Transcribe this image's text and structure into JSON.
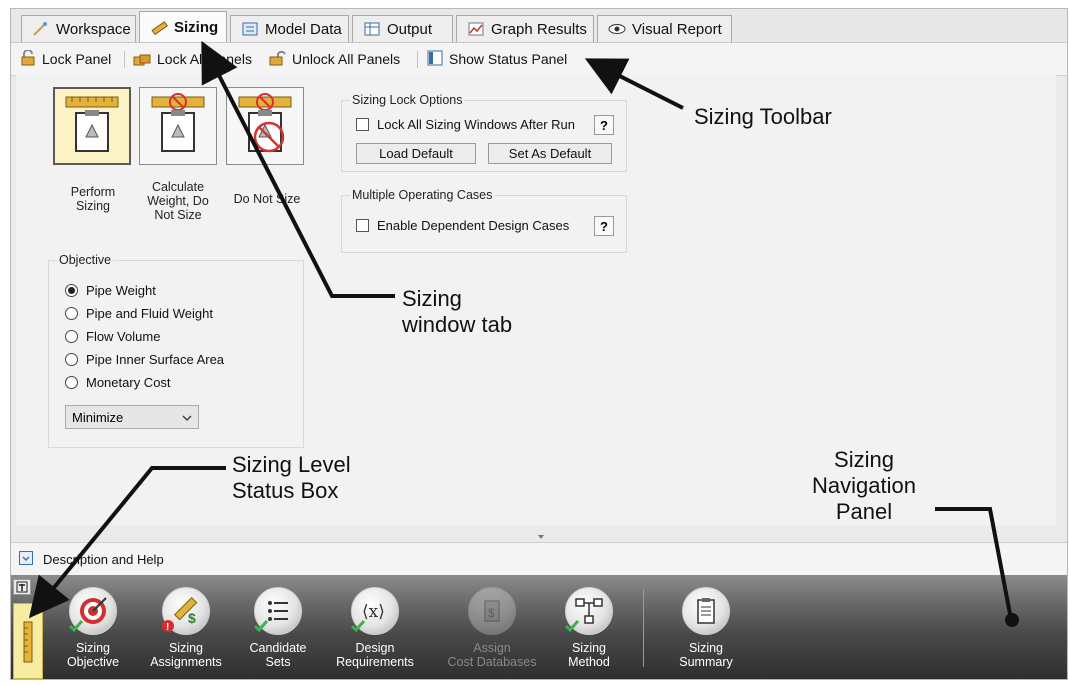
{
  "tabs": [
    {
      "label": "Workspace",
      "icon": "workspace-icon"
    },
    {
      "label": "Sizing",
      "icon": "ruler-icon",
      "active": true
    },
    {
      "label": "Model Data",
      "icon": "model-data-icon"
    },
    {
      "label": "Output",
      "icon": "output-icon"
    },
    {
      "label": "Graph Results",
      "icon": "graph-icon"
    },
    {
      "label": "Visual Report",
      "icon": "eye-icon"
    }
  ],
  "toolbar": {
    "lock_panel": "Lock Panel",
    "lock_all": "Lock All Panels",
    "unlock_all": "Unlock All Panels",
    "show_status": "Show Status Panel"
  },
  "sizing_modes": [
    {
      "label": "Perform Sizing",
      "selected": true
    },
    {
      "label": "Calculate Weight, Do Not Size"
    },
    {
      "label": "Do Not Size"
    }
  ],
  "lock_options": {
    "title": "Sizing Lock Options",
    "lock_all_label": "Lock All Sizing Windows After Run",
    "help": "?",
    "load_default": "Load Default",
    "set_default": "Set As Default"
  },
  "multiple_cases": {
    "title": "Multiple Operating Cases",
    "enable_label": "Enable Dependent Design Cases",
    "help": "?"
  },
  "objective": {
    "title": "Objective",
    "options": [
      "Pipe Weight",
      "Pipe and Fluid Weight",
      "Flow Volume",
      "Pipe Inner Surface Area",
      "Monetary Cost"
    ],
    "selected": "Pipe Weight",
    "direction": "Minimize"
  },
  "description_bar": {
    "label": "Description and Help"
  },
  "nav_items": [
    {
      "label1": "Sizing",
      "label2": "Objective"
    },
    {
      "label1": "Sizing",
      "label2": "Assignments"
    },
    {
      "label1": "Candidate",
      "label2": "Sets"
    },
    {
      "label1": "Design",
      "label2": "Requirements"
    },
    {
      "label1": "Assign",
      "label2": "Cost Databases",
      "disabled": true
    },
    {
      "label1": "Sizing",
      "label2": "Method"
    },
    {
      "label1": "Sizing",
      "label2": "Summary"
    }
  ],
  "annotations": {
    "toolbar": "Sizing Toolbar",
    "tab_line1": "Sizing",
    "tab_line2": "window tab",
    "status_line1": "Sizing Level",
    "status_line2": "Status Box",
    "nav_line1": "Sizing",
    "nav_line2": "Navigation",
    "nav_line3": "Panel"
  },
  "colors": {
    "status_box": "#f7eda2",
    "selected_button": "#fbf3c6",
    "check_green": "#3bb34a"
  }
}
